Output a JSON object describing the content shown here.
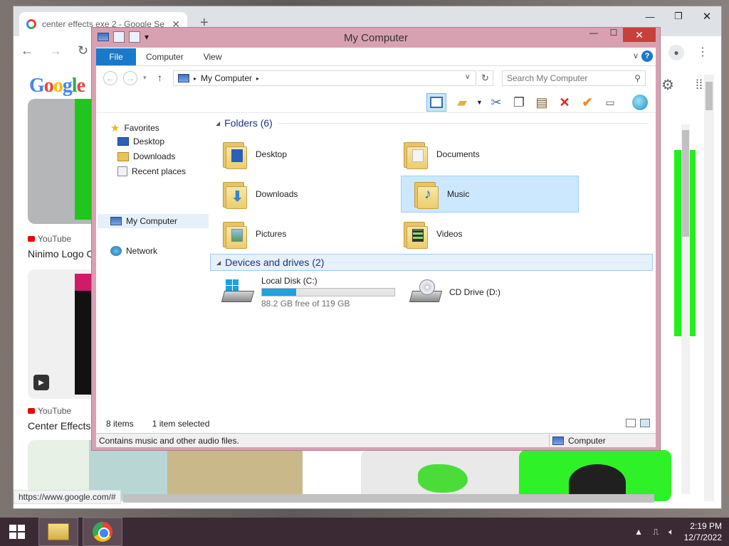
{
  "chrome": {
    "tab_title": "center effects exe 2 - Google Se",
    "status_url": "https://www.google.com/#",
    "google_letters": [
      "G",
      "o",
      "o",
      "g",
      "l",
      "e"
    ],
    "results": [
      {
        "source": "YouTube",
        "title": "Ninimo Logo C"
      },
      {
        "source": "YouTube",
        "title": "Center Effects"
      }
    ]
  },
  "explorer": {
    "title": "My Computer",
    "ribbon_tabs": {
      "file": "File",
      "computer": "Computer",
      "view": "View"
    },
    "help": "?",
    "address": {
      "location": "My Computer"
    },
    "search": {
      "placeholder": "Search My Computer"
    },
    "nav_pane": {
      "favorites": "Favorites",
      "desktop": "Desktop",
      "downloads": "Downloads",
      "recent": "Recent places",
      "mycomputer": "My Computer",
      "network": "Network"
    },
    "groups": {
      "folders": "Folders (6)",
      "devices": "Devices and drives (2)"
    },
    "folders": {
      "desktop": "Desktop",
      "documents": "Documents",
      "downloads": "Downloads",
      "music": "Music",
      "pictures": "Pictures",
      "videos": "Videos"
    },
    "drives": {
      "c": {
        "label": "Local Disk (C:)",
        "free": "88.2 GB free of 119 GB",
        "used_fraction": 0.26
      },
      "d": {
        "label": "CD Drive (D:)"
      }
    },
    "status": {
      "items": "8 items",
      "selected": "1 item selected",
      "description": "Contains music and other audio files.",
      "location": "Computer"
    }
  },
  "taskbar": {
    "time": "2:19 PM",
    "date": "12/7/2022"
  }
}
